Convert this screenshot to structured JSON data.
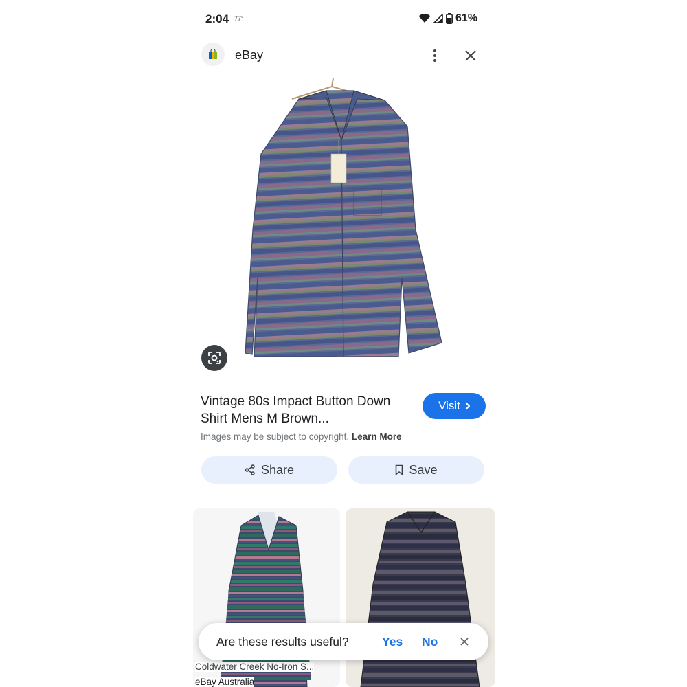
{
  "status_bar": {
    "time": "2:04",
    "temp": "77°",
    "battery": "61%"
  },
  "header": {
    "site_name": "eBay",
    "icons": [
      "ebay-bag-icon",
      "more-vert-icon",
      "close-icon"
    ]
  },
  "result": {
    "title": "Vintage 80s Impact Button Down Shirt Mens M Brown...",
    "visit_label": "Visit",
    "copyright_text": "Images may be subject to copyright.",
    "learn_more": "Learn More",
    "share_label": "Share",
    "save_label": "Save"
  },
  "related": [
    {
      "title": "Coldwater Creek No-Iron S...",
      "source": "eBay Australia"
    },
    {
      "title": "",
      "source": ""
    }
  ],
  "feedback": {
    "question": "Are these results useful?",
    "yes": "Yes",
    "no": "No"
  },
  "colors": {
    "accent": "#1a73e8",
    "pill_bg": "#e8f0fe",
    "text": "#202124",
    "muted": "#70757a"
  }
}
